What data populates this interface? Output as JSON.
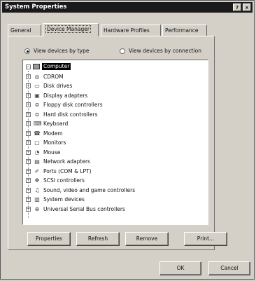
{
  "window": {
    "title": "System Properties"
  },
  "titlebar_buttons": {
    "help": "?",
    "close": "×"
  },
  "tabs": [
    {
      "label": "General",
      "active": false
    },
    {
      "label": "Device Manager",
      "active": true
    },
    {
      "label": "Hardware Profiles",
      "active": false
    },
    {
      "label": "Performance",
      "active": false
    }
  ],
  "view_options": {
    "by_type": "View devices by type",
    "by_connection": "View devices by connection",
    "selected": "by_type"
  },
  "tree": {
    "root": "Computer",
    "items": [
      {
        "label": "CDROM",
        "icon": "cdrom-icon",
        "glyph": "◎"
      },
      {
        "label": "Disk drives",
        "icon": "disk-drive-icon",
        "glyph": "▭"
      },
      {
        "label": "Display adapters",
        "icon": "display-adapter-icon",
        "glyph": "▣"
      },
      {
        "label": "Floppy disk controllers",
        "icon": "floppy-controller-icon",
        "glyph": "⊜"
      },
      {
        "label": "Hard disk controllers",
        "icon": "hard-disk-controller-icon",
        "glyph": "⊜"
      },
      {
        "label": "Keyboard",
        "icon": "keyboard-icon",
        "glyph": "⌨"
      },
      {
        "label": "Modem",
        "icon": "modem-icon",
        "glyph": "☎"
      },
      {
        "label": "Monitors",
        "icon": "monitor-icon",
        "glyph": "▢"
      },
      {
        "label": "Mouse",
        "icon": "mouse-icon",
        "glyph": "◔"
      },
      {
        "label": "Network adapters",
        "icon": "network-adapter-icon",
        "glyph": "▤"
      },
      {
        "label": "Ports (COM & LPT)",
        "icon": "ports-icon",
        "glyph": "✐"
      },
      {
        "label": "SCSI controllers",
        "icon": "scsi-controller-icon",
        "glyph": "✥"
      },
      {
        "label": "Sound, video and game controllers",
        "icon": "sound-icon",
        "glyph": "♫"
      },
      {
        "label": "System devices",
        "icon": "system-devices-icon",
        "glyph": "▥"
      },
      {
        "label": "Universal Serial Bus controllers",
        "icon": "usb-icon",
        "glyph": "⊕"
      }
    ]
  },
  "actions": {
    "properties": "Properties",
    "refresh": "Refresh",
    "remove": "Remove",
    "print": "Print..."
  },
  "dialog": {
    "ok": "OK",
    "cancel": "Cancel"
  }
}
